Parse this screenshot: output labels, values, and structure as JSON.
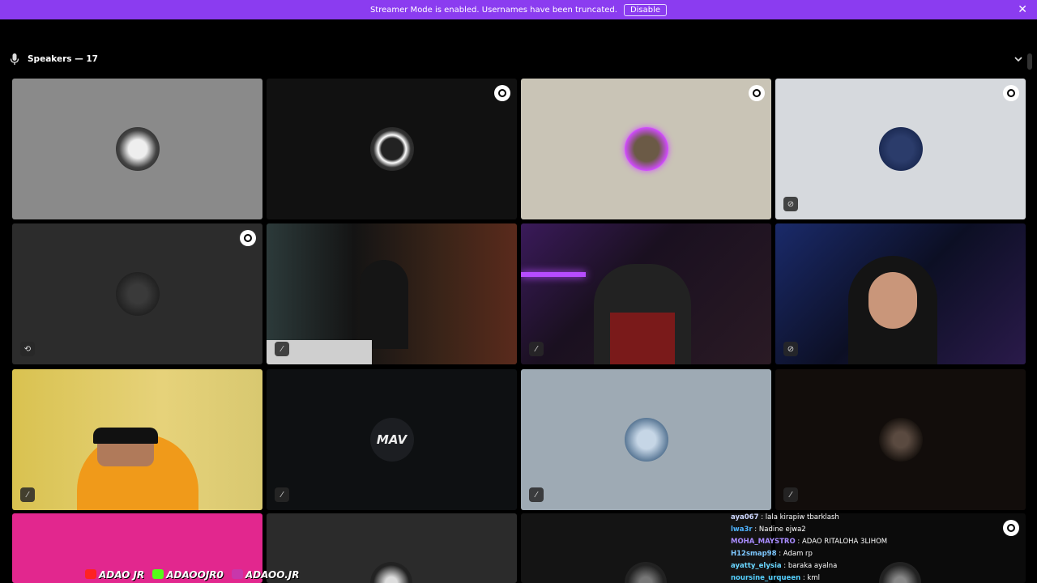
{
  "banner": {
    "message": "Streamer Mode is enabled. Usernames have been truncated.",
    "disable_label": "Disable",
    "close_glyph": "✕",
    "color": "#8b3cf0"
  },
  "section": {
    "title": "Speakers — 17"
  },
  "tiles": [
    {
      "kind": "avatar",
      "bg": "#8a8a8a",
      "avatar": "white-framed-portrait"
    },
    {
      "kind": "avatar",
      "bg": "#111111",
      "avatar": "spider-web-portrait",
      "shield": true
    },
    {
      "kind": "avatar",
      "bg": "#c9c4b6",
      "avatar": "pink-glow-portrait",
      "shield": true
    },
    {
      "kind": "avatar",
      "bg": "#d6d9dd",
      "avatar": "goodnight-logo",
      "shield": true,
      "corner": "video-off-icon"
    },
    {
      "kind": "avatar",
      "bg": "#2c2c2c",
      "avatar": "dark-hand-portrait",
      "shield": true,
      "corner": "screen-share-icon"
    },
    {
      "kind": "video",
      "bg": "#1d1914",
      "corner": "mic-off-icon"
    },
    {
      "kind": "video",
      "bg": "#1c1424",
      "corner": "mic-off-icon"
    },
    {
      "kind": "video",
      "bg": "#10142a",
      "corner": "video-off-icon"
    },
    {
      "kind": "video",
      "bg": "#c2a44c",
      "corner": "mic-off-icon"
    },
    {
      "kind": "avatar",
      "bg": "#0e1012",
      "avatar": "mav-logo",
      "corner": "mic-off-icon"
    },
    {
      "kind": "avatar",
      "bg": "#9eaab4",
      "avatar": "cap-portrait",
      "corner": "mic-off-icon"
    },
    {
      "kind": "avatar",
      "bg": "#120d0b",
      "avatar": "dark-face-portrait",
      "corner": "mic-off-icon"
    },
    {
      "kind": "partial",
      "bg": "#e2278e"
    },
    {
      "kind": "partial",
      "bg": "#2b2b2b"
    },
    {
      "kind": "partial",
      "bg": "#141414"
    },
    {
      "kind": "partial",
      "bg": "#0b0b0b",
      "shield": true
    }
  ],
  "mav_text": "MAV",
  "chat": [
    {
      "user": "aya067",
      "text": "lala kirapiw tbarklash",
      "color": "#cfd8ff"
    },
    {
      "user": "lwa3r",
      "text": "Nadine ejwa2",
      "color": "#4fb4ff"
    },
    {
      "user": "MOHA_MAYSTRO",
      "text": "ADAO RITALOHA 3LIHOM",
      "color": "#a98cff"
    },
    {
      "user": "H12smap98",
      "text": "Adam rp",
      "color": "#7ec8ff"
    },
    {
      "user": "ayatty_elysia",
      "text": "baraka ayalna",
      "color": "#6ad6ff"
    },
    {
      "user": "noursine_urqueen",
      "text": "kml",
      "color": "#55d0ff"
    }
  ],
  "chat_separator": " : ",
  "socials": [
    {
      "label": "ADAO JR",
      "icon": "youtube-icon",
      "color": "#ff2222"
    },
    {
      "label": "ADAOOJR0",
      "icon": "kick-icon",
      "color": "#53fc18"
    },
    {
      "label": "ADAOO.JR",
      "icon": "instagram-icon",
      "color": "#c837ab"
    }
  ]
}
